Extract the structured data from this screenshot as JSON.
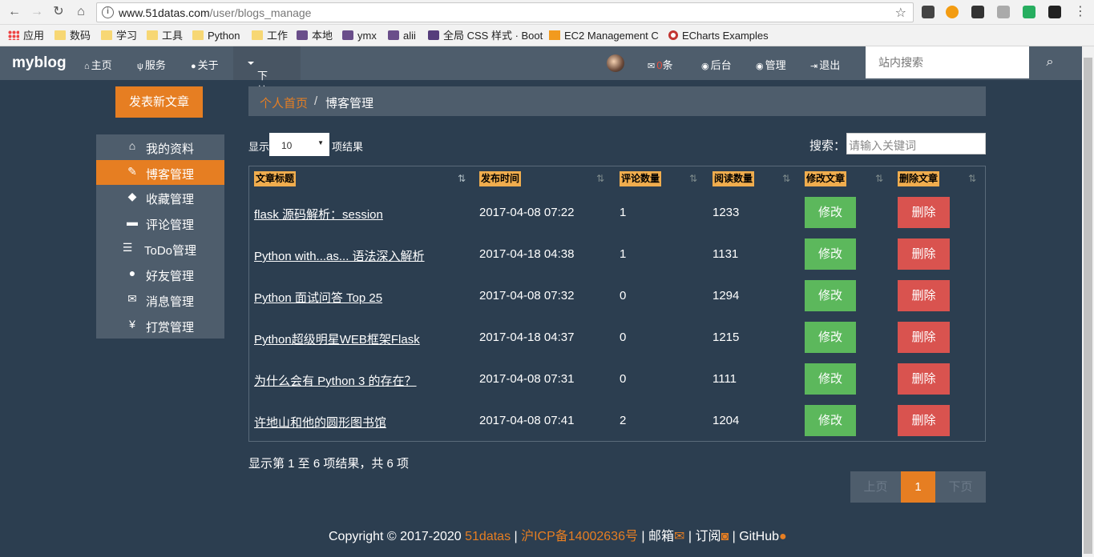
{
  "browser": {
    "url_host": "www.51datas.com",
    "url_path": "/user/blogs_manage",
    "bookmarks": [
      "应用",
      "数码",
      "学习",
      "工具",
      "Python",
      "工作",
      "本地",
      "ymx",
      "alii",
      "全局 CSS 样式 · Boot",
      "EC2 Management C",
      "ECharts Examples"
    ]
  },
  "navbar": {
    "brand": "myblog",
    "home": "主页",
    "services": "服务",
    "about": "关于",
    "dropdown": "下拉框",
    "mail_count": "0",
    "mail_unit": "条",
    "backend": "后台",
    "manage": "管理",
    "logout": "退出",
    "search_placeholder": "站内搜索"
  },
  "sidebar": {
    "new_post": "发表新文章",
    "items": [
      {
        "label": "我的资料",
        "icon": "home-icon"
      },
      {
        "label": "博客管理",
        "icon": "pencil-icon"
      },
      {
        "label": "收藏管理",
        "icon": "tags-icon"
      },
      {
        "label": "评论管理",
        "icon": "comment-icon"
      },
      {
        "label": "ToDo管理",
        "icon": "tasks-icon"
      },
      {
        "label": "好友管理",
        "icon": "user-icon"
      },
      {
        "label": "消息管理",
        "icon": "envelope-icon"
      },
      {
        "label": "打赏管理",
        "icon": "yen-icon"
      }
    ]
  },
  "breadcrumb": {
    "home": "个人首页",
    "sep": "/",
    "current": "博客管理"
  },
  "table_controls": {
    "show": "显示",
    "page_length": "10",
    "items_suffix": "项结果",
    "search_label": "搜索：",
    "search_placeholder": "请输入关键词"
  },
  "table": {
    "headers": [
      "文章标题",
      "发布时间",
      "评论数量",
      "阅读数量",
      "修改文章",
      "删除文章"
    ],
    "edit_label": "修改",
    "delete_label": "删除",
    "rows": [
      {
        "title": "flask 源码解析：session",
        "date": "2017-04-08 07:22",
        "comments": "1",
        "reads": "1233"
      },
      {
        "title": "Python with...as... 语法深入解析",
        "date": "2017-04-18 04:38",
        "comments": "1",
        "reads": "1131"
      },
      {
        "title": "Python 面试问答 Top 25",
        "date": "2017-04-08 07:32",
        "comments": "0",
        "reads": "1294"
      },
      {
        "title": "Python超级明星WEB框架Flask",
        "date": "2017-04-18 04:37",
        "comments": "0",
        "reads": "1215"
      },
      {
        "title": "为什么会有 Python 3 的存在？",
        "date": "2017-04-08 07:31",
        "comments": "0",
        "reads": "1111"
      },
      {
        "title": "许地山和他的圆形图书馆",
        "date": "2017-04-08 07:41",
        "comments": "2",
        "reads": "1204"
      }
    ]
  },
  "pagination": {
    "info": "显示第 1 至 6 项结果，共 6 项",
    "prev": "上页",
    "current": "1",
    "next": "下页"
  },
  "footer": {
    "copyright": "Copyright © 2017-2020",
    "site": "51datas",
    "icp": "沪ICP备14002636号",
    "mail": "邮箱",
    "subscribe": "订阅",
    "github": "GitHub"
  },
  "colors": {
    "background": "#2c3e50",
    "panel": "#4e5d6c",
    "accent": "#e67e22",
    "success": "#5cb85c",
    "danger": "#d9534f",
    "header_label": "#f0ad4e"
  }
}
